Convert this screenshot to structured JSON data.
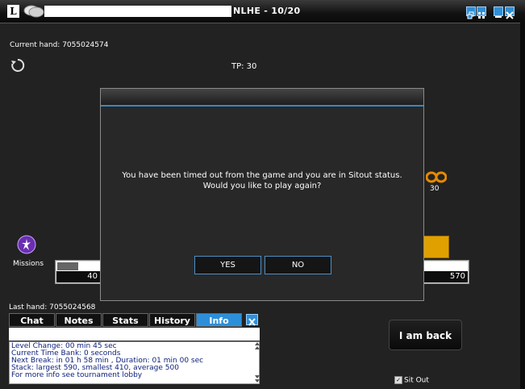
{
  "window": {
    "logo": "L",
    "title": "NLHE - 10/20",
    "colors": {
      "titlebar": "#111111",
      "accent": "#2d8fd9",
      "table_bg": "#222222"
    }
  },
  "table": {
    "current_hand": "Current hand: 7055024574",
    "total_pot": "TP: 30",
    "chips_bet": "30",
    "missions_label": "Missions",
    "seats": [
      {
        "stack": "40"
      },
      {
        "stack": "570"
      }
    ]
  },
  "dialog": {
    "message": "You have been timed out from the game and you are in Sitout status. Would you like to play again?",
    "yes_label": "YES",
    "no_label": "NO"
  },
  "panel": {
    "last_hand": "Last hand: 7055024568",
    "tabs": [
      {
        "label": "Chat"
      },
      {
        "label": "Notes"
      },
      {
        "label": "Stats"
      },
      {
        "label": "History"
      },
      {
        "label": "Info",
        "active": true
      }
    ],
    "info_lines": [
      "Level Change: 00 min 45 sec",
      "Current Time Bank: 0 seconds",
      "Next Break: in 01 h 58 min , Duration: 01 min 00 sec",
      "Stack: largest 590, smallest 410, average 500",
      "For more info see tournament lobby"
    ]
  },
  "actions": {
    "i_am_back": "I am back",
    "sit_out_label": "Sit Out",
    "sit_out_checked": true
  },
  "icons": [
    "chat-bubbles-icon",
    "restore-icon",
    "grid-icon",
    "minimize-icon",
    "close-icon",
    "refresh-icon",
    "chips-icon",
    "missions-icon",
    "close-panel-icon",
    "scroll-arrows-icon",
    "checkmark-icon"
  ]
}
